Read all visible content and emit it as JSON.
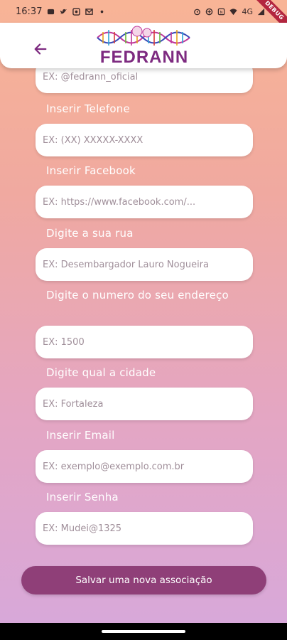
{
  "status_bar": {
    "time": "16:37",
    "network": "4G"
  },
  "debug_banner": "DEBUG",
  "app_bar": {
    "logo_text": "FEDRANN"
  },
  "form": {
    "instagram": {
      "placeholder": "EX: @fedrann_oficial"
    },
    "phone": {
      "label": "Inserir Telefone",
      "placeholder": "EX: (XX) XXXXX-XXXX"
    },
    "facebook": {
      "label": "Inserir Facebook",
      "placeholder": "EX: https://www.facebook.com/..."
    },
    "street": {
      "label": "Digite a sua rua",
      "placeholder": "EX: Desembargador Lauro Nogueira"
    },
    "number": {
      "label": "Digite o numero do seu endereço",
      "placeholder": "EX: 1500"
    },
    "city": {
      "label": "Digite qual a cidade",
      "placeholder": "EX: Fortaleza"
    },
    "email": {
      "label": "Inserir Email",
      "placeholder": "EX: exemplo@exemplo.com.br"
    },
    "password": {
      "label": "Inserir Senha",
      "placeholder": "EX: Mudei@1325"
    }
  },
  "save_button": {
    "label": "Salvar uma nova associação"
  },
  "colors": {
    "brand": "#7d2a80",
    "button": "#8f3f78",
    "gradient_top": "#f8b496",
    "gradient_bottom": "#d7a8db"
  }
}
